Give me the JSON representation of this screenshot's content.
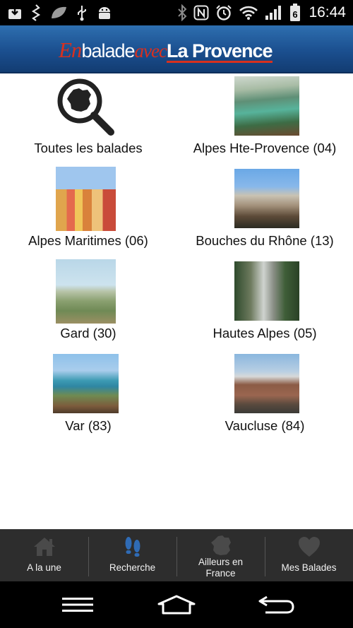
{
  "status_bar": {
    "left_icons": [
      "download-box-icon",
      "usb-debug-icon",
      "leaf-icon",
      "usb-icon",
      "android-icon"
    ],
    "right_icons": [
      "bluetooth-icon",
      "nfc-icon",
      "alarm-icon",
      "wifi-icon",
      "signal-icon",
      "battery-icon"
    ],
    "battery_level": "6",
    "time": "16:44"
  },
  "header": {
    "logo_en": "En",
    "logo_balade": "balade",
    "logo_avec": "avec",
    "logo_la_provence": "La Provence",
    "brand_color": "#1b4f8f",
    "accent_color": "#d9301e"
  },
  "destinations": [
    {
      "label": "Toutes les balades",
      "icon": "map-search-icon"
    },
    {
      "label": "Alpes Hte-Provence (04)",
      "icon": "lake-photo"
    },
    {
      "label": "Alpes Maritimes (06)",
      "icon": "town-photo"
    },
    {
      "label": "Bouches du Rhône (13)",
      "icon": "calanque-photo"
    },
    {
      "label": "Gard (30)",
      "icon": "village-photo"
    },
    {
      "label": "Hautes Alpes (05)",
      "icon": "footbridge-photo"
    },
    {
      "label": "Var (83)",
      "icon": "lake-gorge-photo"
    },
    {
      "label": "Vaucluse (84)",
      "icon": "cyclist-photo"
    }
  ],
  "tabbar": {
    "tabs": [
      {
        "label": "A la une",
        "icon": "home-icon",
        "active": false
      },
      {
        "label": "Recherche",
        "icon": "footsteps-icon",
        "active": true
      },
      {
        "label": "Ailleurs en France",
        "icon": "france-map-icon",
        "active": false
      },
      {
        "label": "Mes Balades",
        "icon": "heart-icon",
        "active": false
      }
    ],
    "active_color": "#2f6bb5",
    "inactive_icon_color": "#4a4a4a"
  },
  "navbar": {
    "buttons": [
      "menu-icon",
      "home-outline-icon",
      "back-icon"
    ]
  }
}
